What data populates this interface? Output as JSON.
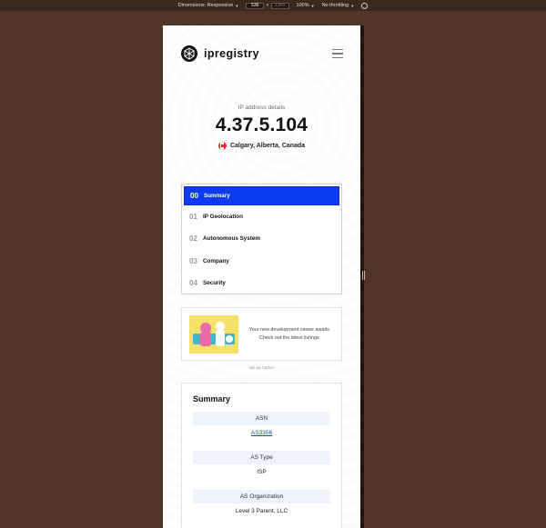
{
  "devtools": {
    "dimensions_label": "Dimensions: Responsive",
    "width_value": "536",
    "height_value": "1369",
    "zoom_label": "100%",
    "throttle_label": "No throttling"
  },
  "header": {
    "brand": "ipregistry",
    "logo_icon": "globe-logo-icon",
    "menu_icon": "hamburger-menu-icon"
  },
  "hero": {
    "label": "IP address details",
    "ip": "4.37.5.104",
    "location": "Calgary, Alberta, Canada",
    "flag_icon": "canada-flag-icon"
  },
  "nav": {
    "items": [
      {
        "num": "00",
        "label": "Summary",
        "active": true
      },
      {
        "num": "01",
        "label": "IP Geolocation",
        "active": false
      },
      {
        "num": "02",
        "label": "Autonomous System",
        "active": false
      },
      {
        "num": "03",
        "label": "Company",
        "active": false
      },
      {
        "num": "04",
        "label": "Security",
        "active": false
      }
    ],
    "active_color": "#0b3cf0"
  },
  "ad": {
    "text": "Your new development career awaits. Check out the latest listings.",
    "via": "ads via Carbon"
  },
  "summary": {
    "title": "Summary",
    "fields": [
      {
        "label": "ASN",
        "value": "AS3356",
        "link": true
      },
      {
        "label": "AS Type",
        "value": "ISP",
        "link": false
      },
      {
        "label": "AS Organization",
        "value": "Level 3 Parent, LLC",
        "link": false
      }
    ]
  }
}
